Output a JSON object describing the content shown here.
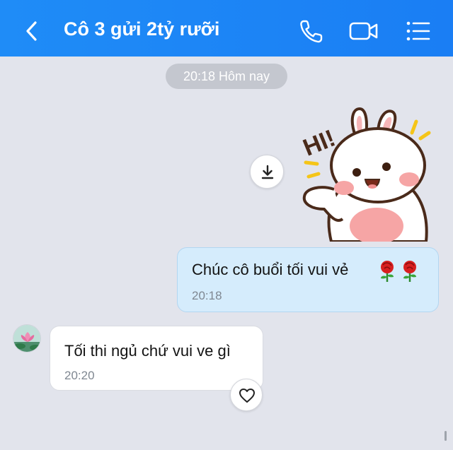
{
  "header": {
    "title": "Cô 3 gửi 2tỷ rưỡi",
    "back_icon": "chevron-left-icon",
    "call_icon": "phone-icon",
    "video_icon": "video-camera-icon",
    "menu_icon": "menu-list-icon",
    "background_color": "#1a7ef4"
  },
  "conversation": {
    "date_divider": "20:18 Hôm nay",
    "sticker": {
      "caption": "HI!",
      "description": "bunny-waving-sticker",
      "download_icon": "download-icon"
    },
    "messages": [
      {
        "direction": "outgoing",
        "text": "Chúc cô buổi tối vui vẻ",
        "emoji": "rose-emoji",
        "time": "20:18",
        "bubble_color": "#d5ecfc"
      },
      {
        "direction": "incoming",
        "text": "Tối thi ngủ chứ vui ve gì",
        "time": "20:20",
        "bubble_color": "#ffffff",
        "avatar_icon": "lotus-avatar",
        "reaction_icon": "heart-outline-icon"
      }
    ]
  }
}
